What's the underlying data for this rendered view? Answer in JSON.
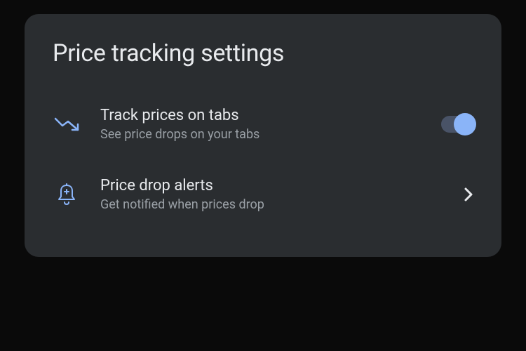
{
  "header": {
    "title": "Price tracking settings"
  },
  "settings": {
    "trackPrices": {
      "title": "Track prices on tabs",
      "subtitle": "See price drops on your tabs",
      "enabled": true
    },
    "priceDropAlerts": {
      "title": "Price drop alerts",
      "subtitle": "Get notified when prices drop"
    }
  },
  "icons": {
    "trendDown": "trend-down-icon",
    "bellAdd": "bell-add-icon",
    "chevronRight": "chevron-right-icon"
  },
  "colors": {
    "accent": "#8ab4f8",
    "cardBg": "#2a2d30",
    "textPrimary": "#e8eaed",
    "textSecondary": "#9aa0a6"
  }
}
